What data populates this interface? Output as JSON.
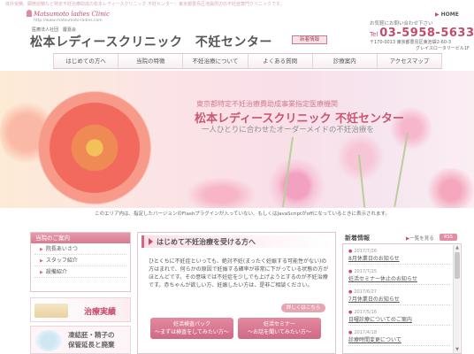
{
  "top_line": "体外受精、顕微授精など特定不妊治療助成の松本レディースクリニック 不妊センター：東京都豊島区池袋周辺の不妊症専門クリニックです。",
  "header": {
    "logo_script": "Matsumoto ladies Clinic",
    "logo_url": "http://www.matsumoto-ladies.com",
    "org_line": "医療法人社団　慶嘉会",
    "site_title": "松本レディースクリニック　不妊センター",
    "home_link": "HOME",
    "news_button": "新着情報",
    "contact_label": "お気軽にお問い合わせ下さい",
    "tel_prefix": "Tel",
    "tel_number": "03-5958-5633",
    "address": "〒170-0013 東京都豊島区東池袋2-60-3",
    "building": "グレイスロータリービル1F"
  },
  "nav": {
    "items": [
      {
        "label": "はじめての方へ"
      },
      {
        "label": "当院の特徴"
      },
      {
        "label": "不妊治療について"
      },
      {
        "label": "よくある質問"
      },
      {
        "label": "診療案内"
      },
      {
        "label": "アクセスマップ"
      }
    ]
  },
  "hero": {
    "subtitle": "東京都特定不妊治療費助成事業指定医療機関",
    "title": "松本レディースクリニック 不妊センター",
    "tagline": "一人ひとりに合わせたオーダーメイドの不妊治療を"
  },
  "flash_note": "このエリア内は、指定したバージョンのFlashプラグインが入っていない、もしくはJavaScriptがoffになっているときに表示されます。",
  "sidebar": {
    "heading": "当院のご案内",
    "items": [
      {
        "label": "院長あいさつ"
      },
      {
        "label": "スタッフ紹介"
      },
      {
        "label": "設備紹介"
      }
    ],
    "banner1": "治療実績",
    "banner2_line1": "凍結胚・精子の",
    "banner2_line2": "保管延長と廃棄"
  },
  "article": {
    "title": "はじめて不妊治療を受ける方へ",
    "body": "ひとくちに不妊症といっても、絶対不妊(まったく妊娠する可能性がない)の方はまれで、何らかの原因で妊娠する確率が非常に下がっている状態の方がほとんどです。その意味では不妊症を少しでも上げようとするのが不妊治療です。赤ちゃんが欲しい方、妊娠したい方は、是非ご相談ください。",
    "more_button": "詳しくはこちら",
    "pill1_line1": "妊活検査パック",
    "pill1_line2": "～まずは検査をしてみたい方～",
    "pill2_line1": "妊活セミナー",
    "pill2_line2": "～お話を聞いてみたい方～"
  },
  "news": {
    "title": "新着情報",
    "list_link": "一覧を見る",
    "rss": "RSS",
    "items": [
      {
        "date": "2017/7/26",
        "text": "8月休業日のお知らせ"
      },
      {
        "date": "2017/7/25",
        "text": "妊活セミナー休止のお知らせ"
      },
      {
        "date": "2017/6/27",
        "text": "7月休業日のお知らせ"
      },
      {
        "date": "2017/5/16",
        "text": "日曜診療についてのご案内"
      },
      {
        "date": "2017/4/18",
        "text": "診療時間変更について"
      }
    ]
  }
}
